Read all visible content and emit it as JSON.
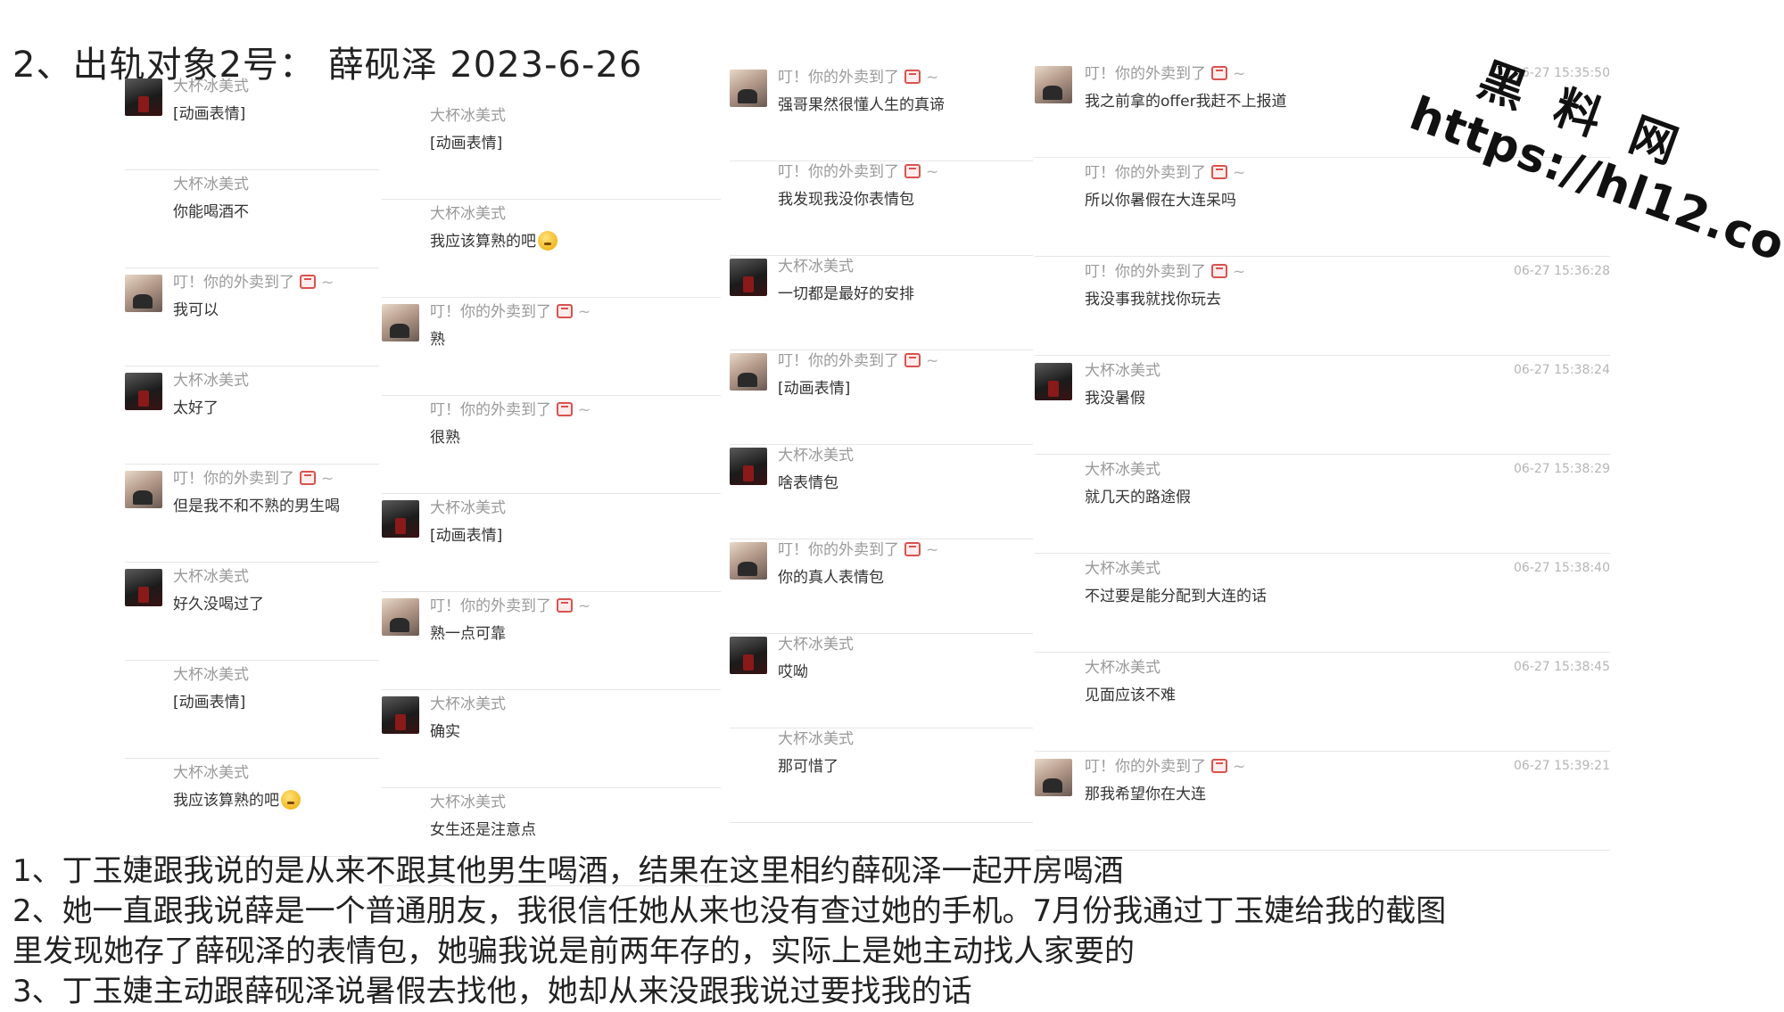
{
  "title": "2、出轨对象2号： 薛砚泽  2023-6-26",
  "watermark": {
    "text": "黑 料 网",
    "url": "https://hl12.co"
  },
  "columns": [
    {
      "messages": [
        {
          "sender": "大杯冰美式",
          "text": "[动画表情]",
          "avatar": "dark"
        },
        {
          "sender": "大杯冰美式",
          "text": "你能喝酒不",
          "avatar": "none"
        },
        {
          "sender": "叮！你的外卖到了",
          "text": "我可以",
          "avatar": "light",
          "cup": true
        },
        {
          "sender": "大杯冰美式",
          "text": "太好了",
          "avatar": "dark"
        },
        {
          "sender": "叮！你的外卖到了",
          "text": "但是我不和不熟的男生喝",
          "avatar": "light",
          "cup": true
        },
        {
          "sender": "大杯冰美式",
          "text": "好久没喝过了",
          "avatar": "dark"
        },
        {
          "sender": "大杯冰美式",
          "text": "[动画表情]",
          "avatar": "none"
        },
        {
          "sender": "大杯冰美式",
          "text": "我应该算熟的吧",
          "avatar": "none",
          "emoji": "smile-emoji"
        }
      ]
    },
    {
      "messages": [
        {
          "sender": "大杯冰美式",
          "text": "[动画表情]",
          "avatar": "none"
        },
        {
          "sender": "大杯冰美式",
          "text": "我应该算熟的吧",
          "avatar": "none",
          "emoji": "smile-emoji"
        },
        {
          "sender": "叮！你的外卖到了",
          "text": "熟",
          "avatar": "light",
          "cup": true
        },
        {
          "sender": "叮！你的外卖到了",
          "text": "很熟",
          "avatar": "none",
          "cup": true
        },
        {
          "sender": "大杯冰美式",
          "text": "[动画表情]",
          "avatar": "dark"
        },
        {
          "sender": "叮！你的外卖到了",
          "text": "熟一点可靠",
          "avatar": "light",
          "cup": true
        },
        {
          "sender": "大杯冰美式",
          "text": "确实",
          "avatar": "dark"
        },
        {
          "sender": "大杯冰美式",
          "text": "女生还是注意点",
          "avatar": "none"
        }
      ]
    },
    {
      "messages": [
        {
          "sender": "叮！你的外卖到了",
          "text": "强哥果然很懂人生的真谛",
          "avatar": "light",
          "cup": true
        },
        {
          "sender": "叮！你的外卖到了",
          "text": "我发现我没你表情包",
          "avatar": "none",
          "cup": true
        },
        {
          "sender": "大杯冰美式",
          "text": "一切都是最好的安排",
          "avatar": "dark"
        },
        {
          "sender": "叮！你的外卖到了",
          "text": "[动画表情]",
          "avatar": "light",
          "cup": true
        },
        {
          "sender": "大杯冰美式",
          "text": "啥表情包",
          "avatar": "dark"
        },
        {
          "sender": "叮！你的外卖到了",
          "text": "你的真人表情包",
          "avatar": "light",
          "cup": true
        },
        {
          "sender": "大杯冰美式",
          "text": "哎呦",
          "avatar": "dark"
        },
        {
          "sender": "大杯冰美式",
          "text": "那可惜了",
          "avatar": "none"
        }
      ]
    },
    {
      "messages": [
        {
          "sender": "叮！你的外卖到了",
          "text": "我之前拿的offer我赶不上报道",
          "avatar": "light",
          "cup": true,
          "time": "06-27 15:35:50"
        },
        {
          "sender": "叮！你的外卖到了",
          "text": "所以你暑假在大连呆吗",
          "avatar": "none",
          "cup": true,
          "time": ""
        },
        {
          "sender": "叮！你的外卖到了",
          "text": "我没事我就找你玩去",
          "avatar": "none",
          "cup": true,
          "time": "06-27 15:36:28"
        },
        {
          "sender": "大杯冰美式",
          "text": "我没暑假",
          "avatar": "dark",
          "time": "06-27 15:38:24"
        },
        {
          "sender": "大杯冰美式",
          "text": "就几天的路途假",
          "avatar": "none",
          "time": "06-27 15:38:29"
        },
        {
          "sender": "大杯冰美式",
          "text": "不过要是能分配到大连的话",
          "avatar": "none",
          "time": "06-27 15:38:40"
        },
        {
          "sender": "大杯冰美式",
          "text": "见面应该不难",
          "avatar": "none",
          "time": "06-27 15:38:45"
        },
        {
          "sender": "叮！你的外卖到了",
          "text": "那我希望你在大连",
          "avatar": "light",
          "cup": true,
          "time": "06-27 15:39:21"
        }
      ]
    }
  ],
  "notes": [
    "1、丁玉婕跟我说的是从来不跟其他男生喝酒，结果在这里相约薛砚泽一起开房喝酒",
    "2、她一直跟我说薛是一个普通朋友，我很信任她从来也没有查过她的手机。7月份我通过丁玉婕给我的截图",
    "里发现她存了薛砚泽的表情包，她骗我说是前两年存的，实际上是她主动找人家要的",
    "3、丁玉婕主动跟薛砚泽说暑假去找他，她却从来没跟我说过要找我的话"
  ]
}
